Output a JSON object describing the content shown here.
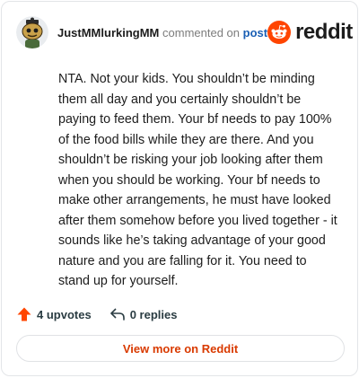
{
  "header": {
    "username": "JustMMlurkingMM",
    "action_text": "commented on",
    "post_link": "post",
    "brand": "reddit"
  },
  "comment": {
    "text": "NTA. Not your kids. You shouldn’t be minding them all day and you certainly shouldn’t be paying to feed them. Your bf needs to pay 100% of the food bills while they are there. And you shouldn’t be risking your job looking after them when you should be working. Your bf needs to make other arrangements, he must have looked after them somehow before you lived together - it sounds like he’s taking advantage of your good nature and you are falling for it. You need to stand up for yourself."
  },
  "actions": {
    "upvotes": "4 upvotes",
    "replies": "0 replies"
  },
  "footer": {
    "view_more": "View more on Reddit"
  },
  "colors": {
    "brand_orange": "#ff4500",
    "upvote": "#ff4500",
    "link_blue": "#1a5fb4",
    "view_more_text": "#d93a00"
  },
  "icons": {
    "avatar": "snoo-avatar",
    "logo": "reddit-logo-icon",
    "upvote": "upvote-arrow-icon",
    "reply": "reply-arrow-icon"
  }
}
